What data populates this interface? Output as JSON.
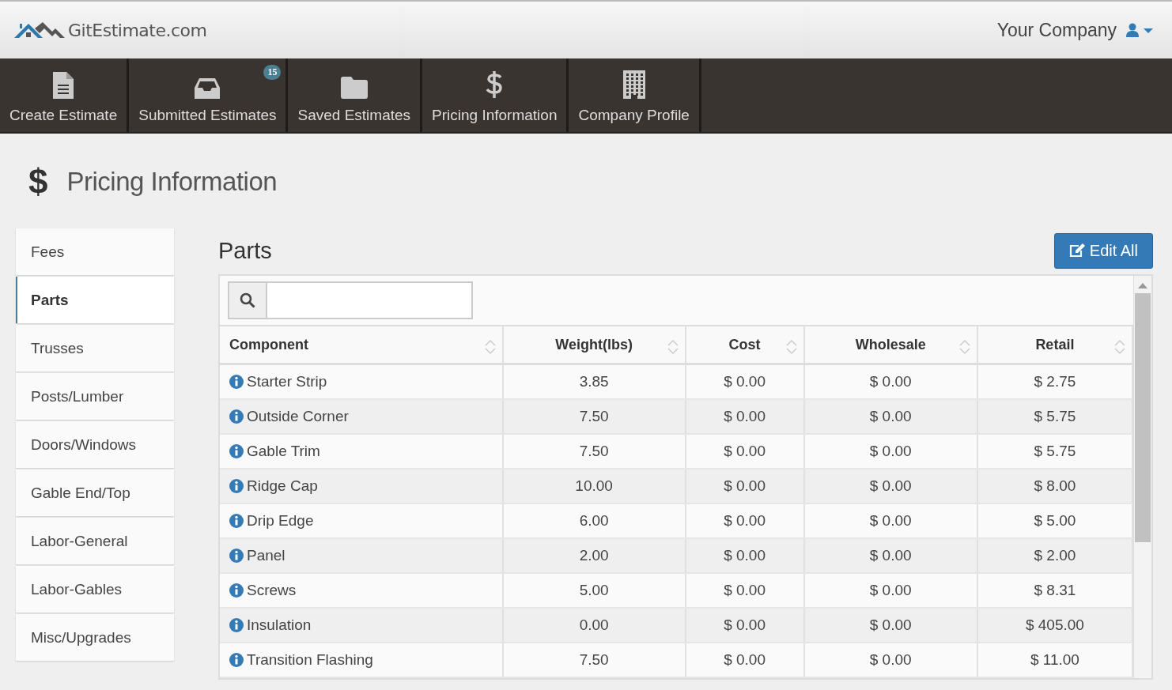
{
  "header": {
    "logo": "GitEstimate.com",
    "company": "Your Company"
  },
  "nav": [
    {
      "label": "Create Estimate",
      "kind": "document"
    },
    {
      "label": "Submitted Estimates",
      "kind": "inbox",
      "badge": "15"
    },
    {
      "label": "Saved Estimates",
      "kind": "folder"
    },
    {
      "label": "Pricing Information",
      "kind": "dollar"
    },
    {
      "label": "Company Profile",
      "kind": "building"
    }
  ],
  "page_title": {
    "icon": "$",
    "text": "Pricing Information"
  },
  "sidebar": {
    "items": [
      {
        "label": "Fees",
        "selected": false
      },
      {
        "label": "Parts",
        "selected": true
      },
      {
        "label": "Trusses",
        "selected": false
      },
      {
        "label": "Posts/Lumber",
        "selected": false
      },
      {
        "label": "Doors/Windows",
        "selected": false
      },
      {
        "label": "Gable End/Top",
        "selected": false
      },
      {
        "label": "Labor-General",
        "selected": false
      },
      {
        "label": "Labor-Gables",
        "selected": false
      },
      {
        "label": "Misc/Upgrades",
        "selected": false
      }
    ]
  },
  "section": {
    "title": "Parts",
    "edit_button": "Edit All"
  },
  "table": {
    "columns": [
      "Component",
      "Weight(lbs)",
      "Cost",
      "Wholesale",
      "Retail"
    ],
    "rows": [
      [
        "Starter Strip",
        "3.85",
        "$ 0.00",
        "$ 0.00",
        "$ 2.75"
      ],
      [
        "Outside Corner",
        "7.50",
        "$ 0.00",
        "$ 0.00",
        "$ 5.75"
      ],
      [
        "Gable Trim",
        "7.50",
        "$ 0.00",
        "$ 0.00",
        "$ 5.75"
      ],
      [
        "Ridge Cap",
        "10.00",
        "$ 0.00",
        "$ 0.00",
        "$ 8.00"
      ],
      [
        "Drip Edge",
        "6.00",
        "$ 0.00",
        "$ 0.00",
        "$ 5.00"
      ],
      [
        "Panel",
        "2.00",
        "$ 0.00",
        "$ 0.00",
        "$ 2.00"
      ],
      [
        "Screws",
        "5.00",
        "$ 0.00",
        "$ 0.00",
        "$ 8.31"
      ],
      [
        "Insulation",
        "0.00",
        "$ 0.00",
        "$ 0.00",
        "$ 405.00"
      ],
      [
        "Transition Flashing",
        "7.50",
        "$ 0.00",
        "$ 0.00",
        "$ 11.00"
      ]
    ]
  }
}
